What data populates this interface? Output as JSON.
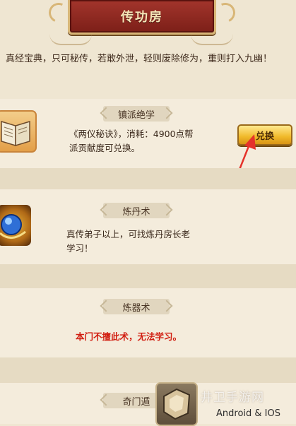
{
  "header": {
    "title": "传功房"
  },
  "intro": {
    "text": "真经宝典，只可秘传，若敢外泄，轻则废除修为，重则打入九幽！"
  },
  "sections": [
    {
      "tag": "镇派绝学",
      "desc_line1": "《两仪秘诀》，消耗：4900点帮",
      "desc_line2": "派贡献度可兑换。",
      "button_label": "兑换",
      "icon": "book-icon"
    },
    {
      "tag": "炼丹术",
      "desc_line1": "真传弟子以上，可找炼丹房长老",
      "desc_line2": "学习！",
      "icon": "elixir-orb-icon"
    },
    {
      "tag": "炼器术",
      "desc_line1": "本门不擅此术，无法学习。"
    },
    {
      "tag": "奇门遁",
      "icon": "stone-icon"
    }
  ],
  "watermark": {
    "logo_text": "井卫手游网",
    "platform_text": "Android & IOS"
  },
  "colors": {
    "title_red": "#8f2820",
    "accent_gold": "#f0b92a",
    "warning_red": "#d11d10",
    "annotation_red": "#e5322b"
  }
}
